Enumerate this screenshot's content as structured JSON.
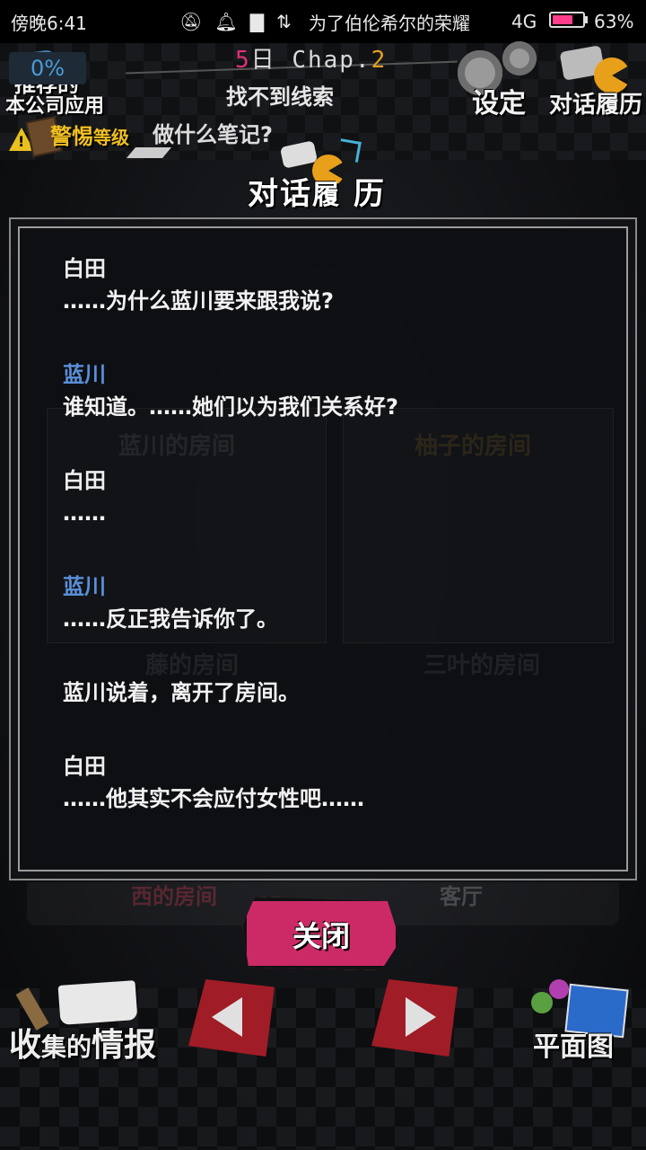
{
  "status_bar": {
    "time": "傍晚6:41",
    "song": "为了伯伦希尔的荣耀",
    "network": "4G",
    "battery": "63%",
    "battery_level": 0.63
  },
  "header": {
    "app_promo_line1": "推荐的",
    "app_promo_line2": "本公司应用",
    "chapter_day_num": "5",
    "chapter_day_unit": "日",
    "chapter_word": "Chap.",
    "chapter_num": "2",
    "objective": "找不到线索",
    "settings_label": "设定",
    "history_label": "对话履历"
  },
  "alert": {
    "label": "警惕",
    "label_small": "等级",
    "percent": "0%",
    "note": "做什么笔记?"
  },
  "panel": {
    "title_a": "对话",
    "title_b": "履",
    "title_c": "历",
    "entries": [
      {
        "speaker": "白田",
        "line": "……为什么蓝川要来跟我说?"
      },
      {
        "speaker": "蓝川",
        "line": "谁知道。……她们以为我们关系好?"
      },
      {
        "speaker": "白田",
        "line": "……"
      },
      {
        "speaker": "蓝川",
        "line": "……反正我告诉你了。"
      },
      {
        "speaker": "",
        "line": "蓝川说着，离开了房间。"
      },
      {
        "speaker": "白田",
        "line": "……他其实不会应付女性吧……"
      }
    ]
  },
  "background_rooms": {
    "room_a": "蓝川的房间",
    "room_b": "柚子的房间",
    "room_c": "藤的房间",
    "room_d": "三叶的房间",
    "room_e": "西的房间",
    "room_f": "客厅"
  },
  "controls": {
    "close_label": "关闭",
    "collect_label_a": "收",
    "collect_label_b": "集的",
    "collect_label_c": "情报",
    "map_label": "平面图"
  },
  "colors": {
    "speaker_blue": "#5a8fd8",
    "close_pink": "#cc2a66",
    "arrow_red": "#a01c26",
    "chapter_pink": "#e0307a",
    "chapter_orange": "#e6a020"
  }
}
